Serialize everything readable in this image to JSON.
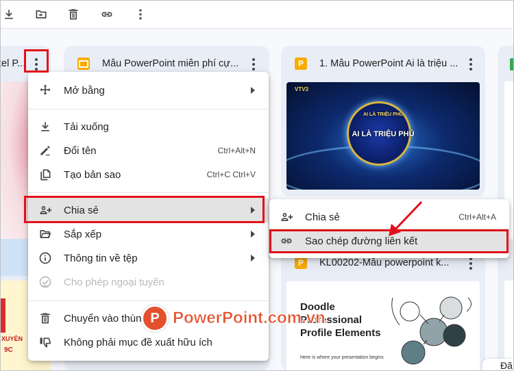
{
  "toolbar": {
    "icons": [
      "download-icon",
      "move-to-folder-icon",
      "trash-icon",
      "link-icon",
      "more-vert-icon"
    ]
  },
  "cards": {
    "left": {
      "title": "tel P..."
    },
    "middle": {
      "title": "Mẫu PowerPoint miễn phí cự..."
    },
    "right": {
      "title": "1. Mẫu PowerPoint Ai là triệu ..."
    },
    "bottom": {
      "title": "KL00202-Mẫu powerpoint k..."
    }
  },
  "thumbnails": {
    "tv": {
      "channel": "VTV3",
      "logo_top": "AI LÀ TRIỆU PHÚ",
      "logo_main": "AI LÀ TRIỆU PHÚ"
    },
    "doodle": {
      "title_line1": "Doodle",
      "title_line2": "Professional",
      "title_line3": "Profile Elements",
      "subtitle": "Here is where your presentation begins"
    },
    "left_bottom": {
      "text1": "XUYÊN",
      "text2": "9C"
    }
  },
  "context_menu": {
    "open_with": "Mở bằng",
    "download": "Tải xuống",
    "rename": "Đổi tên",
    "rename_shortcut": "Ctrl+Alt+N",
    "copy": "Tạo bản sao",
    "copy_shortcut": "Ctrl+C Ctrl+V",
    "share": "Chia sẻ",
    "organize": "Sắp xếp",
    "file_info": "Thông tin về tệp",
    "offline": "Cho phép ngoại tuyến",
    "trash": "Chuyển vào thùng rác",
    "not_suggestion": "Không phải mục đề xuất hữu ích"
  },
  "share_submenu": {
    "share": "Chia sẻ",
    "share_shortcut": "Ctrl+Alt+A",
    "copy_link": "Sao chép đường liên kết"
  },
  "partial_text": {
    "bottom_right": "Đã"
  },
  "watermark": {
    "logo_letter": "P",
    "text": "PowerPoint.com.vn"
  },
  "colors": {
    "highlight": "#e10f1a",
    "slides_yellow": "#f9ab00",
    "watermark": "#e4502d"
  }
}
